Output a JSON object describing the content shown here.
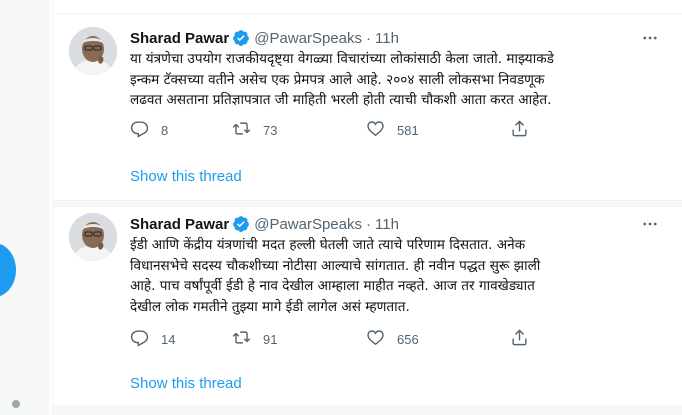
{
  "tweets": [
    {
      "author_name": "Sharad Pawar",
      "handle": "@PawarSpeaks",
      "separator": "·",
      "time": "11h",
      "lines": [
        "या यंत्रणेचा उपयोग राजकीयदृष्ट्या वेगळ्या विचारांच्या लोकांसाठी केला जातो. माझ्याकडे",
        "इन्कम टॅक्सच्या वतीने असेच एक प्रेमपत्र आले आहे. २००४ साली लोकसभा निवडणूक",
        "लढवत असताना प्रतिज्ञापत्रात जी माहिती भरली होती त्याची चौकशी आता करत आहेत."
      ],
      "replies": "8",
      "retweets": "73",
      "likes": "581",
      "show_thread": "Show this thread"
    },
    {
      "author_name": "Sharad Pawar",
      "handle": "@PawarSpeaks",
      "separator": "·",
      "time": "11h",
      "lines": [
        "ईडी आणि केंद्रीय यंत्रणांची मदत हल्ली घेतली जाते त्याचे परिणाम दिसतात. अनेक",
        "विधानसभेचे सदस्य चौकशीच्या नोटीसा आल्याचे सांगतात. ही नवीन पद्धत सुरू झाली",
        "आहे. पाच वर्षांपूर्वी ईडी हे नाव देखील आम्हाला माहीत नव्हते. आज तर गावखेड्यात",
        "देखील लोक गमतीने तुझ्या मागे ईडी लागेल असं म्हणतात."
      ],
      "replies": "14",
      "retweets": "91",
      "likes": "656",
      "show_thread": "Show this thread"
    }
  ],
  "icons": {
    "verified": "verified-badge-icon",
    "more": "more-options-icon",
    "reply": "reply-icon",
    "retweet": "retweet-icon",
    "like": "like-icon",
    "share": "share-icon"
  },
  "colors": {
    "accent": "#1d9bf0",
    "text": "#0f1419",
    "secondary": "#536471",
    "border": "#eff3f4"
  }
}
